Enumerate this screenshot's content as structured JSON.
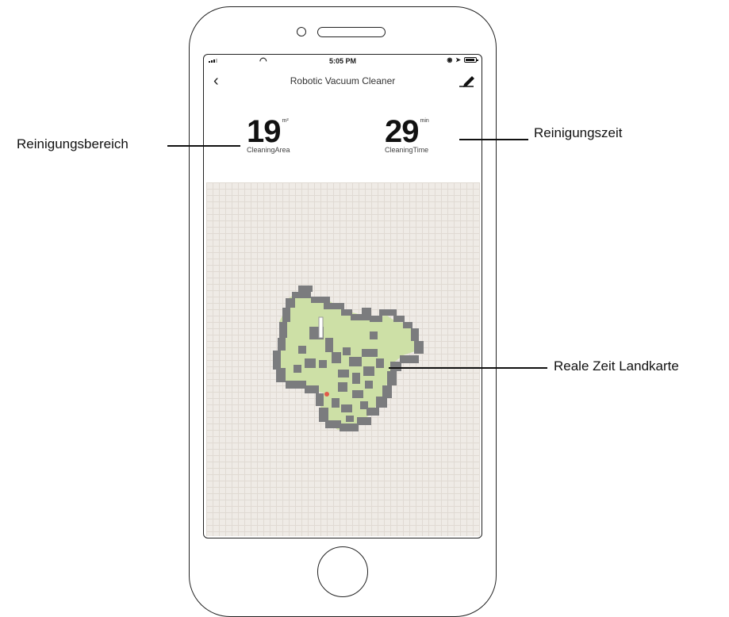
{
  "status_bar": {
    "time": "5:05 PM"
  },
  "header": {
    "title": "Robotic Vacuum Cleaner",
    "back_icon": "chevron-left-icon",
    "edit_icon": "edit-pencil-icon"
  },
  "stats": {
    "area": {
      "value": "19",
      "unit": "m²",
      "label": "CleaningArea"
    },
    "time": {
      "value": "29",
      "unit": "min",
      "label": "CleaningTime"
    }
  },
  "annotations": {
    "area": "Reinigungsbereich",
    "time": "Reinigungszeit",
    "map": "Reale Zeit Landkarte"
  },
  "colors": {
    "map_background": "#efebe6",
    "cleaned_area": "#cde0a6",
    "walls_obstacles": "#7b7c7e",
    "robot_position": "#e25a4a"
  }
}
